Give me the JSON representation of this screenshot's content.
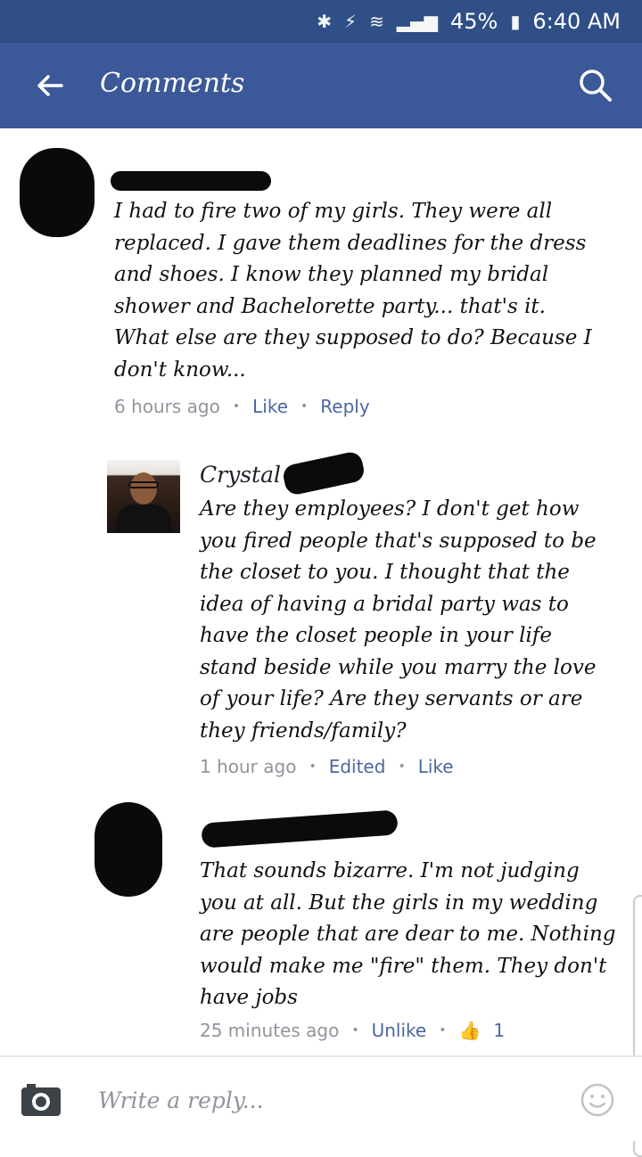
{
  "status_bar": {
    "bluetooth": "✱",
    "data": "⚡",
    "wifi": "≋",
    "signal": "▂▄▆",
    "battery_percent": "45%",
    "battery_icon": "▮",
    "time": "6:40 AM"
  },
  "header": {
    "title": "Comments",
    "back_icon": "arrow-left-icon",
    "search_icon": "search-icon"
  },
  "comments": [
    {
      "name": "",
      "text": "I had to fire two of my girls. They were all replaced. I gave them deadlines for the dress and shoes. I know they planned my bridal shower and Bachelorette party... that's it. What else are they supposed to do? Because I don't know...",
      "time": "6 hours ago",
      "actions": [
        "Like",
        "Reply"
      ]
    },
    {
      "name": "Crystal",
      "text": "Are they employees? I don't get how you fired people that's supposed to be the closet to you. I thought that the idea of having a bridal party was to have the closet people in your life stand beside while you marry the love of your life? Are they servants or are they friends/family?",
      "time": "1 hour ago",
      "actions": [
        "Edited",
        "Like"
      ]
    },
    {
      "name": "",
      "text": "That sounds bizarre. I'm not judging you at all. But the girls in my wedding are people that are dear to me. Nothing would make me \"fire\" them. They don't have jobs",
      "time": "25 minutes ago",
      "actions": [
        "Unlike"
      ],
      "like_count": "1"
    }
  ],
  "reply_bar": {
    "placeholder": "Write a reply...",
    "camera_icon": "camera-icon",
    "emoji_icon": "smiley-icon"
  },
  "colors": {
    "status_bar": "#2f4f86",
    "app_bar": "#3b5998",
    "link": "#4b67a1",
    "meta": "#90949c"
  }
}
